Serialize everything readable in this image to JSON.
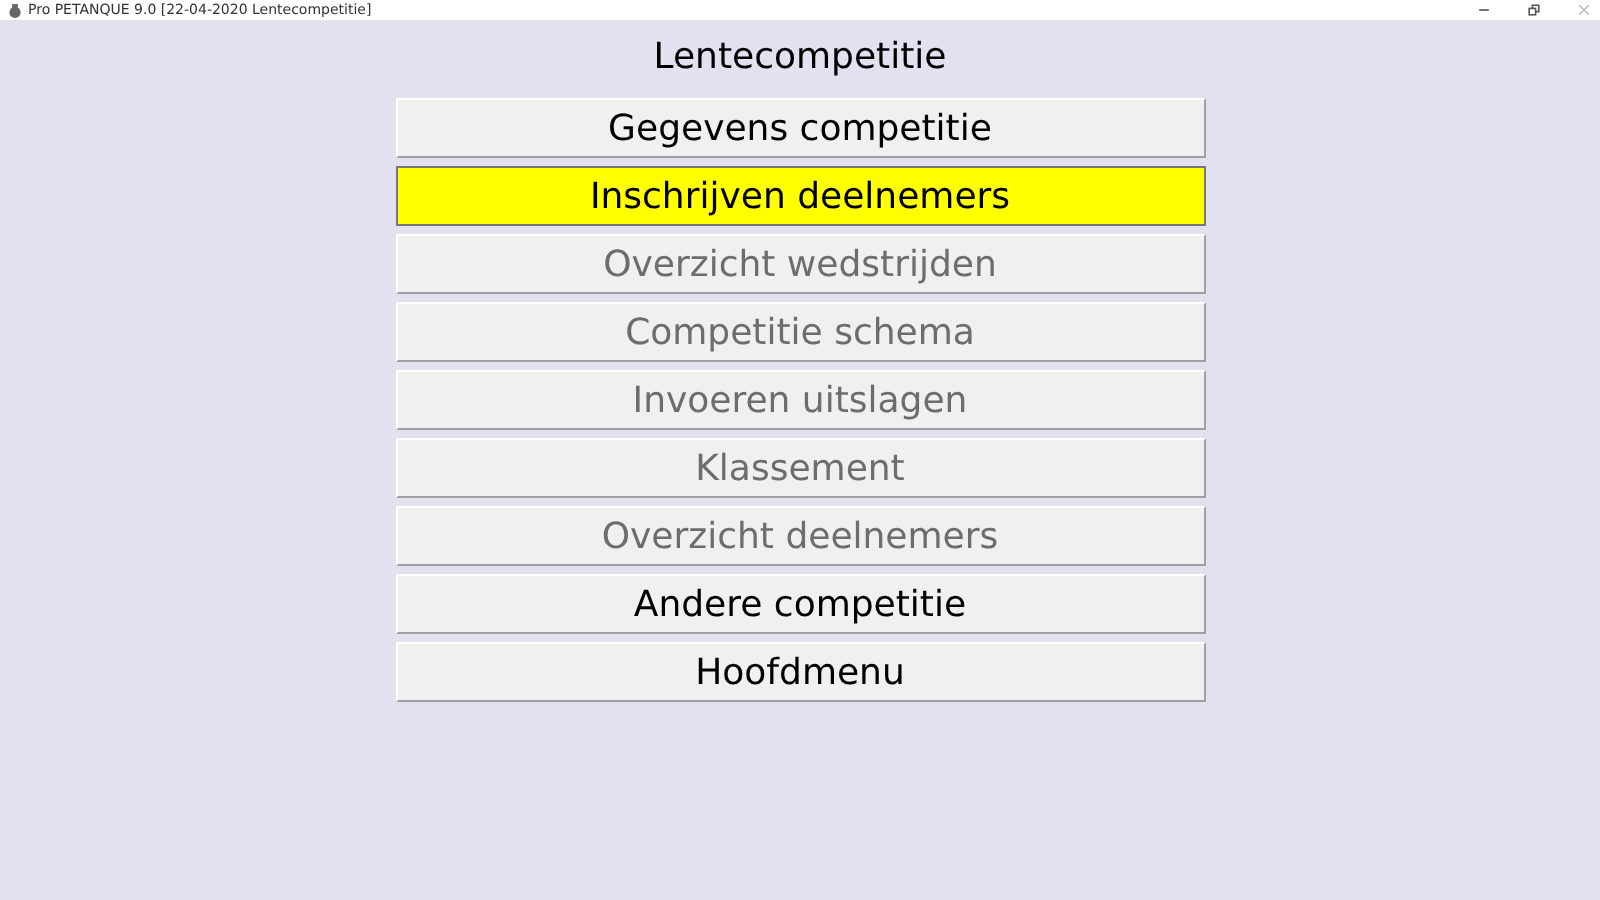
{
  "window": {
    "title": "Pro PETANQUE 9.0 [22-04-2020 Lentecompetitie]"
  },
  "heading": "Lentecompetitie",
  "menu": [
    {
      "label": "Gegevens competitie",
      "selected": false,
      "disabled": false
    },
    {
      "label": "Inschrijven deelnemers",
      "selected": true,
      "disabled": false
    },
    {
      "label": "Overzicht wedstrijden",
      "selected": false,
      "disabled": true
    },
    {
      "label": "Competitie schema",
      "selected": false,
      "disabled": true
    },
    {
      "label": "Invoeren uitslagen",
      "selected": false,
      "disabled": true
    },
    {
      "label": "Klassement",
      "selected": false,
      "disabled": true
    },
    {
      "label": "Overzicht deelnemers",
      "selected": false,
      "disabled": true
    },
    {
      "label": "Andere competitie",
      "selected": false,
      "disabled": false
    },
    {
      "label": "Hoofdmenu",
      "selected": false,
      "disabled": false
    }
  ]
}
